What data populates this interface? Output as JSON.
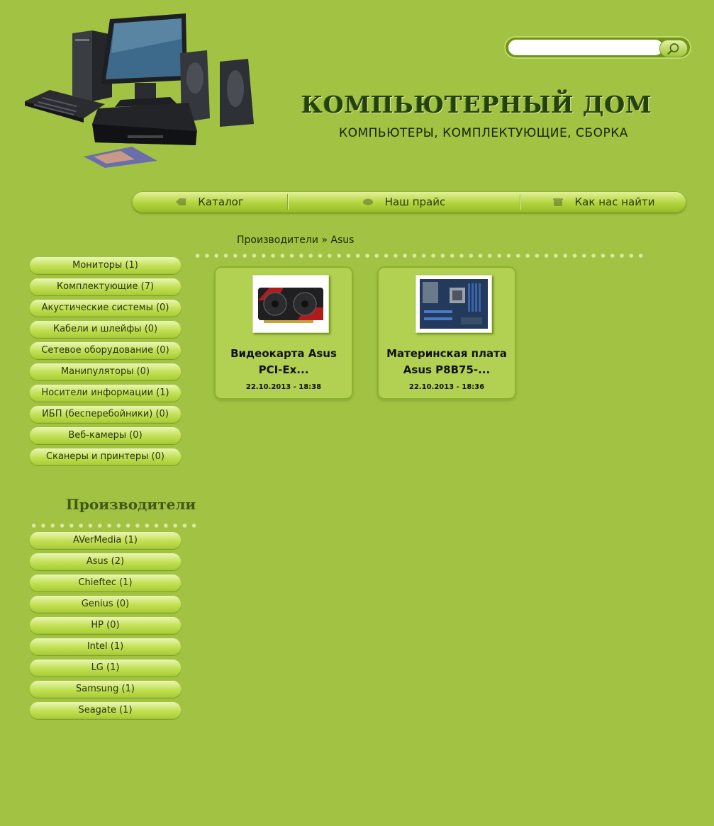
{
  "header": {
    "title": "КОМПЬЮТЕРНЫЙ ДОМ",
    "subtitle": "КОМПЬЮТЕРЫ, КОМПЛЕКТУЮЩИЕ, СБОРКА",
    "search_placeholder": ""
  },
  "nav": [
    {
      "label": "Каталог",
      "icon": "tag-icon"
    },
    {
      "label": "Наш прайс",
      "icon": "price-tag-icon"
    },
    {
      "label": "Как нас найти",
      "icon": "phone-icon"
    }
  ],
  "breadcrumb": {
    "parent": "Производители",
    "separator": "»",
    "current": "Asus"
  },
  "categories": [
    "Мониторы (1)",
    "Комплектующие (7)",
    "Акустические системы (0)",
    "Кабели и шлейфы (0)",
    "Сетевое оборудование (0)",
    "Манипуляторы (0)",
    "Носители информации (1)",
    "ИБП (бесперебойники) (0)",
    "Веб-камеры (0)",
    "Сканеры и принтеры (0)"
  ],
  "manufacturers_title": "Производители",
  "manufacturers": [
    "AVerMedia (1)",
    "Asus (2)",
    "Chieftec (1)",
    "Genius (0)",
    "HP (0)",
    "Intel (1)",
    "LG (1)",
    "Samsung (1)",
    "Seagate (1)"
  ],
  "products": [
    {
      "title_line1": "Видеокарта Asus",
      "title_line2": "PCI-Ex...",
      "date": "22.10.2013 - 18:38",
      "image": "graphics-card-image"
    },
    {
      "title_line1": "Материнская плата",
      "title_line2": "Asus P8B75-...",
      "date": "22.10.2013 - 18:36",
      "image": "motherboard-image"
    }
  ],
  "colors": {
    "background": "#a1c243",
    "accent": "#c2e054",
    "title": "#24420c"
  }
}
